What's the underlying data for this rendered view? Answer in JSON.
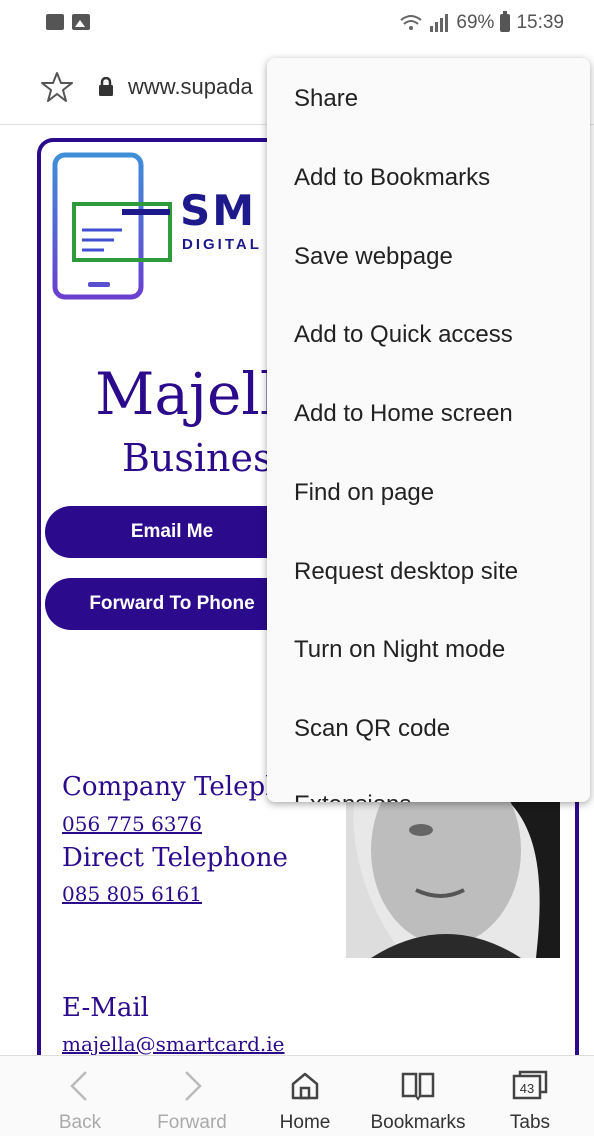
{
  "status_bar": {
    "battery": "69%",
    "time": "15:39"
  },
  "browser": {
    "url": "www.supada"
  },
  "page": {
    "logo_text": "SM",
    "logo_sub": "DIGITAL",
    "name": "Majell",
    "title": "Busines",
    "email_button": "Email Me",
    "forward_button": "Forward To Phone",
    "company_telephone_label": "Company Teleph",
    "company_telephone_value": "056 775 6376",
    "direct_telephone_label": "Direct Telephone",
    "direct_telephone_value": "085 805 6161",
    "email_label": "E-Mail",
    "email_value": "majella@smartcard.ie"
  },
  "menu": {
    "items": [
      "Share",
      "Add to Bookmarks",
      "Save webpage",
      "Add to Quick access",
      "Add to Home screen",
      "Find on page",
      "Request desktop site",
      "Turn on Night mode",
      "Scan QR code",
      "Extensions"
    ]
  },
  "bottom_nav": {
    "back": "Back",
    "forward": "Forward",
    "home": "Home",
    "bookmarks": "Bookmarks",
    "tabs": "Tabs",
    "tab_count": "43"
  },
  "colors": {
    "brand": "#2b0a8c"
  }
}
